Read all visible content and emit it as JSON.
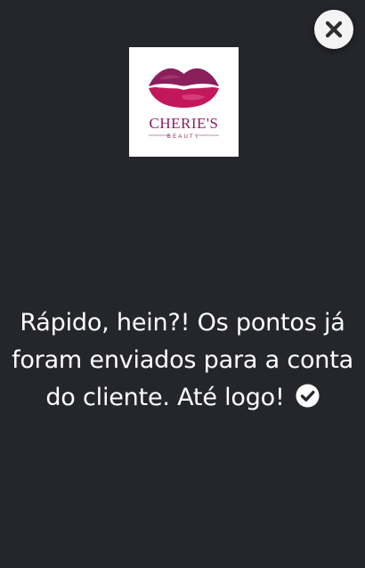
{
  "dialog": {
    "close_icon": "close-icon",
    "logo": {
      "brand_name": "CHERIE'S",
      "brand_sub": "BEAUTY",
      "icon": "lips-logo",
      "colors": {
        "lips_top": "#8a1f5c",
        "lips_bottom": "#c2185b",
        "text": "#8a1f5c"
      }
    },
    "message": "Rápido, hein?! Os pontos já foram enviados para a conta do cliente. Até logo!",
    "message_icon": "check-circle-icon"
  },
  "colors": {
    "background": "#25262b",
    "text": "#ffffff",
    "close_button_bg": "#f4f4f4",
    "close_icon": "#2e2e2e"
  }
}
